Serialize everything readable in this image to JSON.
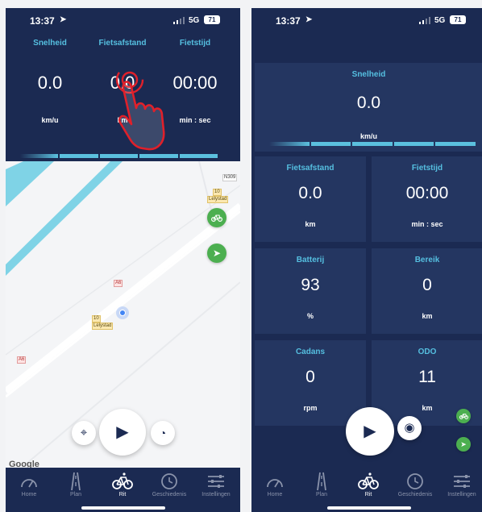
{
  "status": {
    "time": "13:37",
    "network": "5G",
    "battery": "71"
  },
  "left": {
    "metrics": [
      {
        "label": "Snelheid",
        "value": "0.0",
        "unit": "km/u"
      },
      {
        "label": "Fietsafstand",
        "value": "0.0",
        "unit": "km"
      },
      {
        "label": "Fietstijd",
        "value": "00:00",
        "unit": "min : sec"
      }
    ],
    "map": {
      "road_labels": [
        "N309",
        "10",
        "Lelystad",
        "A6",
        "10",
        "Lelystad",
        "A6"
      ],
      "attribution": "Google"
    }
  },
  "right": {
    "speed": {
      "label": "Snelheid",
      "value": "0.0",
      "unit": "km/u"
    },
    "cards": [
      {
        "label": "Fietsafstand",
        "value": "0.0",
        "unit": "km"
      },
      {
        "label": "Fietstijd",
        "value": "00:00",
        "unit": "min : sec"
      },
      {
        "label": "Batterij",
        "value": "93",
        "unit": "%"
      },
      {
        "label": "Bereik",
        "value": "0",
        "unit": "km"
      },
      {
        "label": "Cadans",
        "value": "0",
        "unit": "rpm"
      },
      {
        "label": "ODO",
        "value": "11",
        "unit": "km"
      }
    ]
  },
  "nav": {
    "items": [
      {
        "label": "Home",
        "icon": "speedometer-icon"
      },
      {
        "label": "Plan",
        "icon": "road-icon"
      },
      {
        "label": "Rit",
        "icon": "bicycle-icon"
      },
      {
        "label": "Geschiedenis",
        "icon": "history-icon"
      },
      {
        "label": "Instellingen",
        "icon": "sliders-icon"
      }
    ],
    "active_index": 2
  },
  "colors": {
    "navy": "#1b2a52",
    "card": "#243661",
    "accent": "#55bfe0",
    "green": "#4caf50",
    "hand": "#e0202a"
  }
}
